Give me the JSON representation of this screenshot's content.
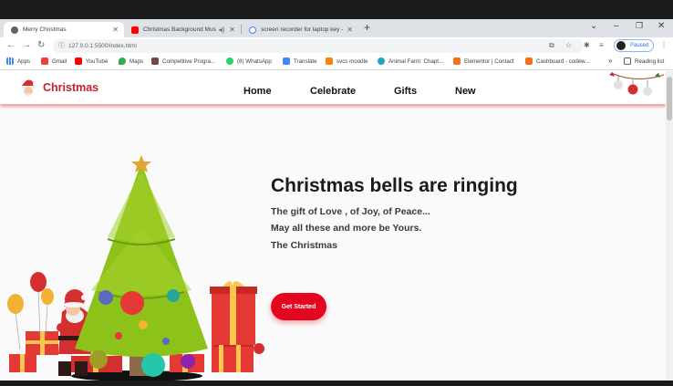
{
  "browser": {
    "tabs": [
      {
        "title": "Merry Christmas",
        "active": true
      },
      {
        "title": "Christmas Background Musi",
        "active": false
      },
      {
        "title": "screen recorder for laptop key -",
        "active": false
      }
    ],
    "url": "127.0.0.1:5500/index.html",
    "profile_label": "Paused",
    "bookmarks": [
      {
        "label": "Apps",
        "icon": "apps-grid-icon"
      },
      {
        "label": "Gmail",
        "icon": "gmail-icon"
      },
      {
        "label": "YouTube",
        "icon": "youtube-icon"
      },
      {
        "label": "Maps",
        "icon": "maps-icon"
      },
      {
        "label": "Competitive Progra...",
        "icon": "bookmark-icon"
      },
      {
        "label": "(8) WhatsApp",
        "icon": "whatsapp-icon"
      },
      {
        "label": "Translate",
        "icon": "translate-icon"
      },
      {
        "label": "svcs moodle",
        "icon": "moodle-icon"
      },
      {
        "label": "Animal Farm: Chapt...",
        "icon": "snowflake-icon"
      },
      {
        "label": "Elementor | Contact",
        "icon": "elementor-icon"
      },
      {
        "label": "Cashboard - codew...",
        "icon": "cashboard-icon"
      }
    ],
    "more_bookmarks": "»",
    "reading_list": "Reading list"
  },
  "site": {
    "logo": "Christmas",
    "nav": [
      "Home",
      "Celebrate",
      "Gifts",
      "New"
    ],
    "hero": {
      "title": "Christmas bells are ringing",
      "lines": [
        "The gift of Love , of Joy, of Peace...",
        "May all these and more be Yours.",
        "The Christmas"
      ],
      "cta": "Get Started"
    }
  },
  "colors": {
    "accent": "#e3061f",
    "logo": "#c41f2a",
    "tree": "#8cc21a"
  }
}
